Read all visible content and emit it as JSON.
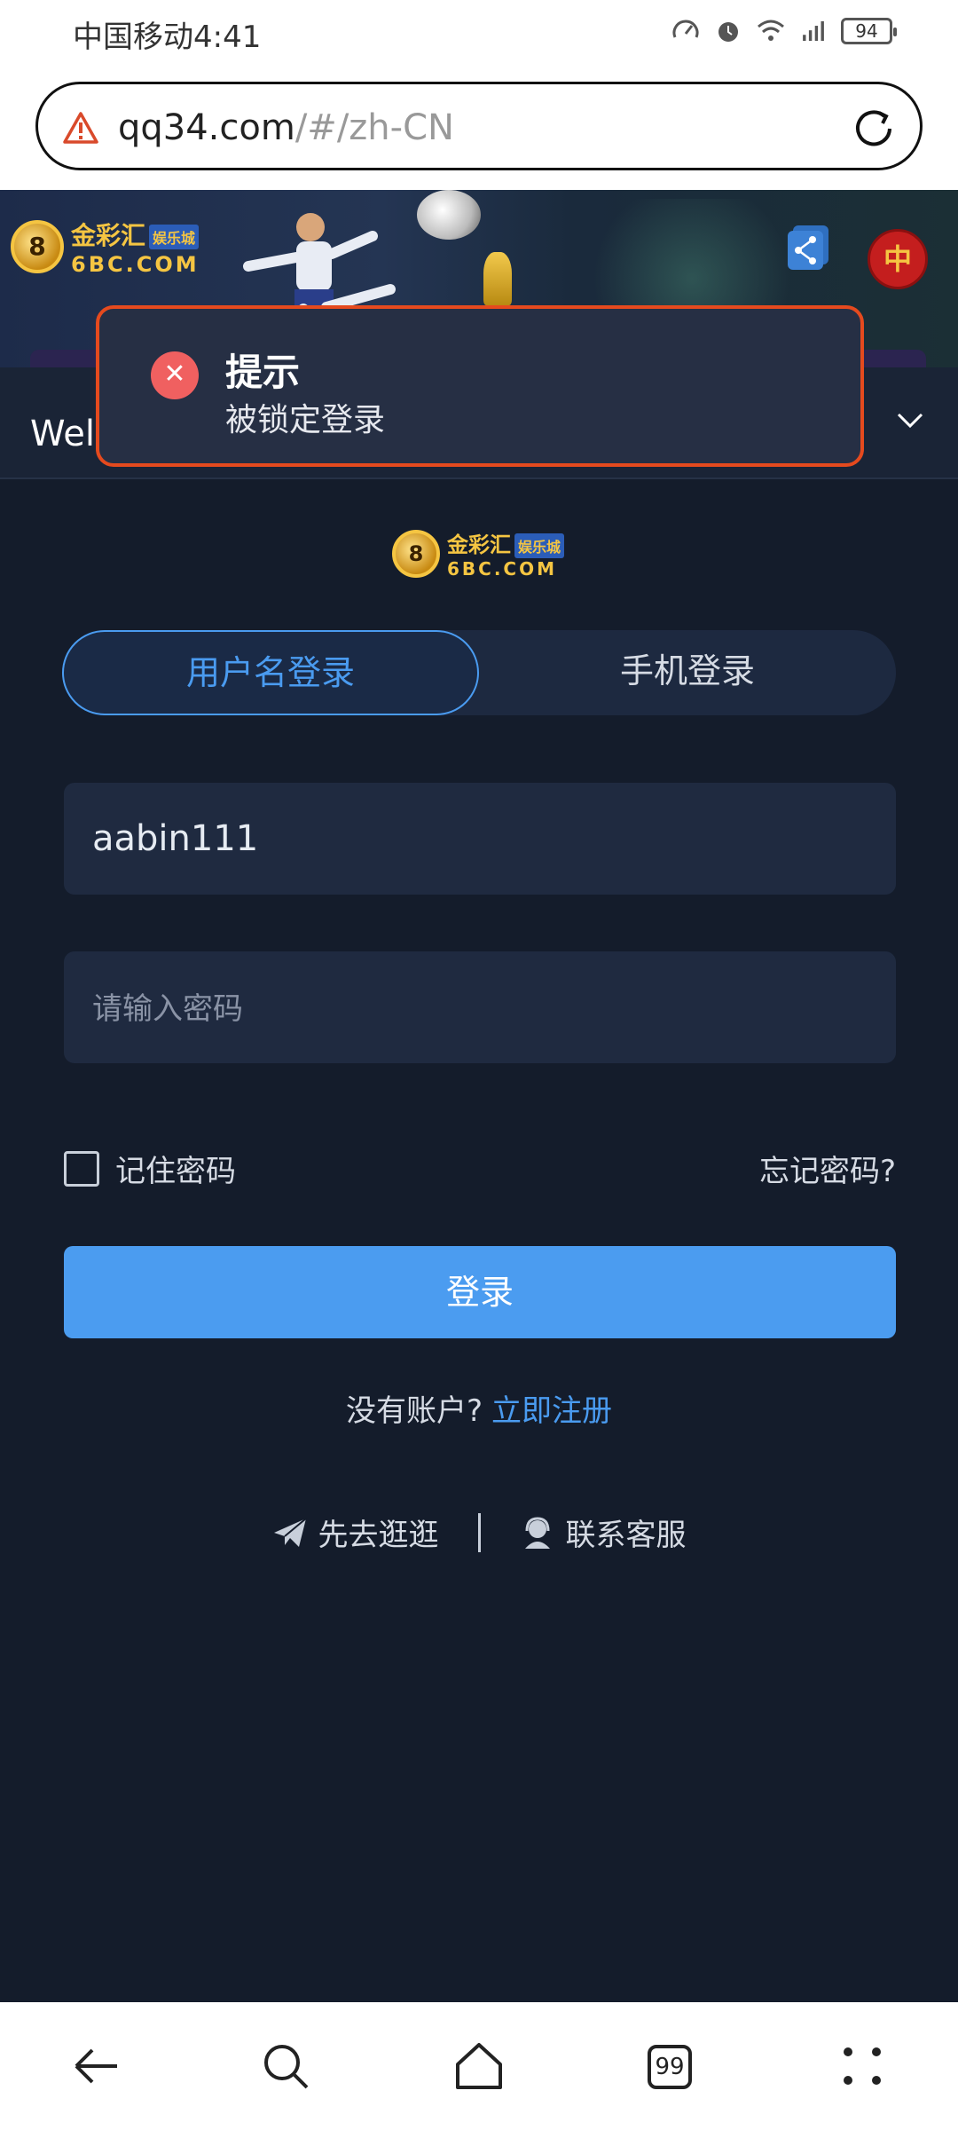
{
  "status_bar": {
    "carrier_time": "中国移动4:41",
    "battery": "94"
  },
  "browser": {
    "url_host": "qq34.com",
    "url_path": "/#/zh-CN",
    "tabs_count": "99"
  },
  "hero": {
    "logo_cn": "金彩汇",
    "logo_tag": "娱乐城",
    "logo_en": "6BC.COM",
    "lang_label": "中"
  },
  "welcome": {
    "text": "Welcome to 金彩汇"
  },
  "toast": {
    "title": "提示",
    "message": "被锁定登录"
  },
  "login": {
    "tabs": [
      {
        "label": "用户名登录"
      },
      {
        "label": "手机登录"
      }
    ],
    "username_value": "aabin111",
    "password_placeholder": "请输入密码",
    "remember_label": "记住密码",
    "forgot_label": "忘记密码?",
    "submit_label": "登录",
    "no_account": "没有账户?",
    "register_link": "立即注册",
    "browse_label": "先去逛逛",
    "support_label": "联系客服"
  },
  "colors": {
    "accent": "#4b9cf0",
    "background": "#141c2b",
    "error": "#e54a1e"
  }
}
